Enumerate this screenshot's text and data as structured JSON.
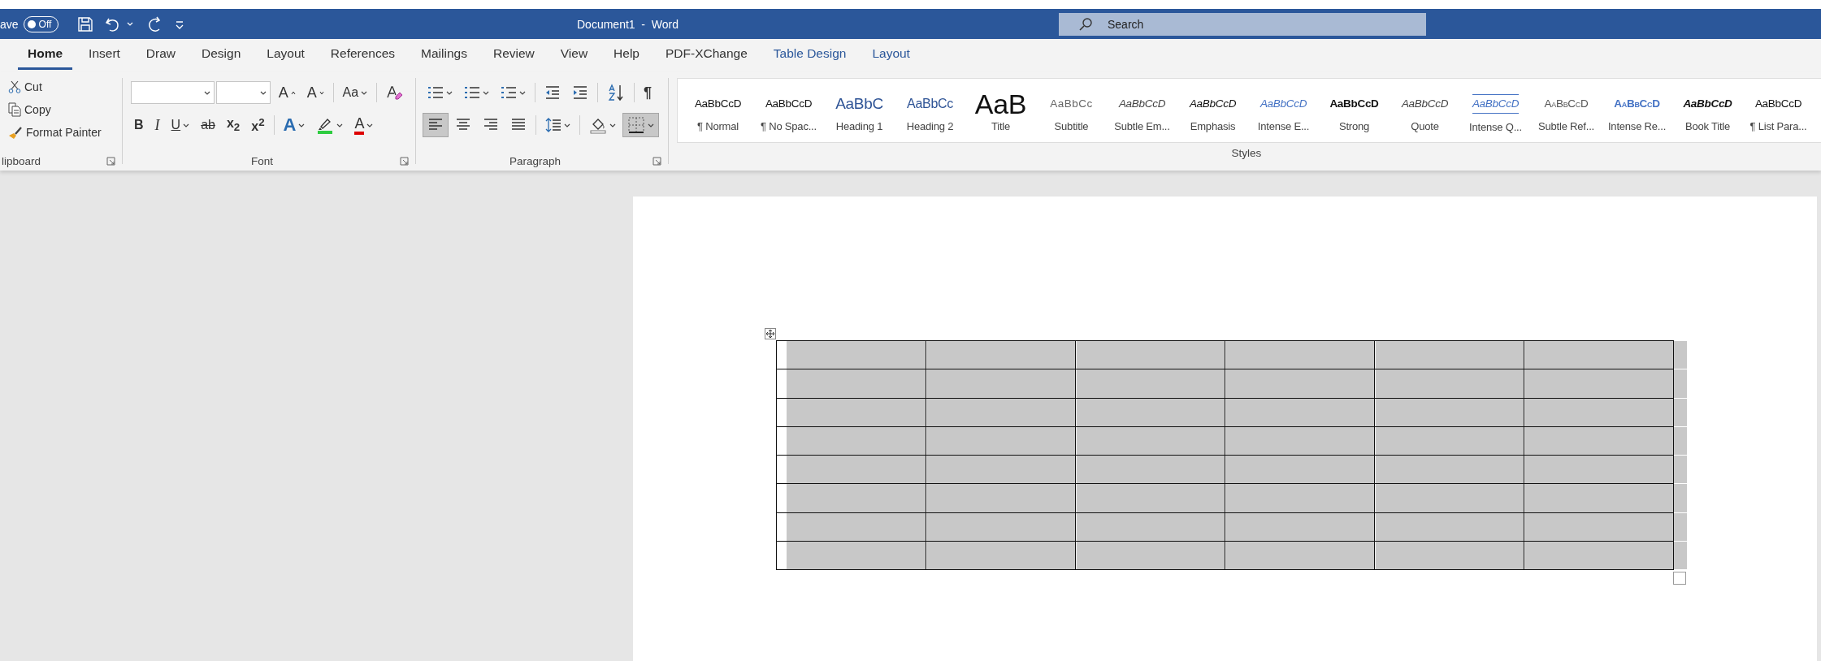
{
  "title_bar": {
    "autosave_label": "ave",
    "autosave_toggle": {
      "label": "Off",
      "on": false
    },
    "title": "Document1  -  Word",
    "search": {
      "placeholder": "Search"
    }
  },
  "tabs": [
    {
      "label": "Home",
      "selected": true,
      "kind": "main"
    },
    {
      "label": "Insert",
      "selected": false,
      "kind": "main"
    },
    {
      "label": "Draw",
      "selected": false,
      "kind": "main"
    },
    {
      "label": "Design",
      "selected": false,
      "kind": "main"
    },
    {
      "label": "Layout",
      "selected": false,
      "kind": "main"
    },
    {
      "label": "References",
      "selected": false,
      "kind": "main"
    },
    {
      "label": "Mailings",
      "selected": false,
      "kind": "main"
    },
    {
      "label": "Review",
      "selected": false,
      "kind": "main"
    },
    {
      "label": "View",
      "selected": false,
      "kind": "main"
    },
    {
      "label": "Help",
      "selected": false,
      "kind": "main"
    },
    {
      "label": "PDF-XChange",
      "selected": false,
      "kind": "main"
    },
    {
      "label": "Table Design",
      "selected": false,
      "kind": "contextual"
    },
    {
      "label": "Layout",
      "selected": false,
      "kind": "contextual"
    }
  ],
  "clipboard": {
    "label": "lipboard",
    "items": [
      {
        "kind": "cut",
        "label": "Cut"
      },
      {
        "kind": "copy",
        "label": "Copy"
      },
      {
        "kind": "format-painter",
        "label": "Format Painter"
      }
    ]
  },
  "font": {
    "label": "Font",
    "row_1": [
      {
        "kind": "grow-font",
        "label": "A"
      },
      {
        "kind": "shrink-font",
        "label": "A"
      },
      {
        "kind": "change-case",
        "label": "Aa",
        "dropdown": true
      },
      {
        "kind": "clear-formatting"
      }
    ],
    "row_2": [
      {
        "kind": "bold",
        "label": "B"
      },
      {
        "kind": "italic",
        "label": "I"
      },
      {
        "kind": "underline",
        "label": "U",
        "dropdown": true
      },
      {
        "kind": "strikethrough",
        "label": "ab"
      },
      {
        "kind": "subscript",
        "label": "x$_{2}$"
      },
      {
        "kind": "superscript",
        "label": "x$^{2}$"
      },
      {
        "kind": "text-effects",
        "label": "A",
        "dropdown": true
      },
      {
        "kind": "highlight",
        "dropdown": true
      },
      {
        "kind": "font-color",
        "label": "A",
        "dropdown": true
      }
    ]
  },
  "paragraph": {
    "label": "Paragraph",
    "row_1": [
      {
        "kind": "bullets",
        "dropdown": true
      },
      {
        "kind": "numbering",
        "dropdown": true
      },
      {
        "kind": "multilevel",
        "dropdown": true
      },
      {
        "kind": "decrease-indent"
      },
      {
        "kind": "increase-indent"
      },
      {
        "kind": "sort"
      },
      {
        "kind": "show-marks",
        "label": "¶"
      }
    ],
    "row_2": [
      {
        "kind": "align-left",
        "selected": true
      },
      {
        "kind": "align-center",
        "selected": false
      },
      {
        "kind": "align-right",
        "selected": false
      },
      {
        "kind": "justify",
        "selected": false
      },
      {
        "kind": "line-spacing",
        "dropdown": true,
        "selected": false
      },
      {
        "kind": "shading",
        "dropdown": true,
        "selected": false
      },
      {
        "kind": "borders",
        "dropdown": true,
        "selected": true
      }
    ]
  },
  "styles": {
    "label": "Styles",
    "items": [
      {
        "kind": "normal",
        "preview": "AaBbCcD",
        "name": "¶ Normal"
      },
      {
        "kind": "normal",
        "preview": "AaBbCcD",
        "name": "¶ No Spac..."
      },
      {
        "kind": "heading-1",
        "preview": "AaBbC",
        "name": "Heading 1"
      },
      {
        "kind": "heading-2",
        "preview": "AaBbCc",
        "name": "Heading 2"
      },
      {
        "kind": "title",
        "preview": "AaB",
        "name": "Title"
      },
      {
        "kind": "subtitle",
        "preview": "AaBbCc",
        "name": "Subtitle"
      },
      {
        "kind": "subtle-emphasis",
        "preview": "AaBbCcD",
        "name": "Subtle Em..."
      },
      {
        "kind": "emphasis",
        "preview": "AaBbCcD",
        "name": "Emphasis"
      },
      {
        "kind": "intense-emphasis",
        "preview": "AaBbCcD",
        "name": "Intense E..."
      },
      {
        "kind": "strong",
        "preview": "AaBbCcD",
        "name": "Strong"
      },
      {
        "kind": "quote",
        "preview": "AaBbCcD",
        "name": "Quote"
      },
      {
        "kind": "intense-quote",
        "preview": "AaBbCcD",
        "name": "Intense Q..."
      },
      {
        "kind": "subtle-reference",
        "preview": "AaBbCcD",
        "name": "Subtle Ref..."
      },
      {
        "kind": "intense-reference",
        "preview": "AaBbCcD",
        "name": "Intense Re..."
      },
      {
        "kind": "book-title",
        "preview": "AaBbCcD",
        "name": "Book Title"
      },
      {
        "kind": "normal",
        "preview": "AaBbCcD",
        "name": "¶ List Para..."
      }
    ]
  },
  "table": {
    "selected": true,
    "rows": [
      {
        "cells": [
          {
            "selected": true
          },
          {
            "selected": true
          },
          {
            "selected": true
          },
          {
            "selected": true
          },
          {
            "selected": true
          },
          {
            "selected": true
          }
        ]
      },
      {
        "cells": [
          {
            "selected": true
          },
          {
            "selected": true
          },
          {
            "selected": true
          },
          {
            "selected": true
          },
          {
            "selected": true
          },
          {
            "selected": true
          }
        ]
      },
      {
        "cells": [
          {
            "selected": true
          },
          {
            "selected": true
          },
          {
            "selected": true
          },
          {
            "selected": true
          },
          {
            "selected": true
          },
          {
            "selected": true
          }
        ]
      },
      {
        "cells": [
          {
            "selected": true
          },
          {
            "selected": true
          },
          {
            "selected": true
          },
          {
            "selected": true
          },
          {
            "selected": true
          },
          {
            "selected": true
          }
        ]
      },
      {
        "cells": [
          {
            "selected": true
          },
          {
            "selected": true
          },
          {
            "selected": true
          },
          {
            "selected": true
          },
          {
            "selected": true
          },
          {
            "selected": true
          }
        ]
      },
      {
        "cells": [
          {
            "selected": true
          },
          {
            "selected": true
          },
          {
            "selected": true
          },
          {
            "selected": true
          },
          {
            "selected": true
          },
          {
            "selected": true
          }
        ]
      },
      {
        "cells": [
          {
            "selected": true
          },
          {
            "selected": true
          },
          {
            "selected": true
          },
          {
            "selected": true
          },
          {
            "selected": true
          },
          {
            "selected": true
          }
        ]
      },
      {
        "cells": [
          {
            "selected": true
          },
          {
            "selected": true
          },
          {
            "selected": true
          },
          {
            "selected": true
          },
          {
            "selected": true
          },
          {
            "selected": true
          }
        ]
      }
    ]
  }
}
